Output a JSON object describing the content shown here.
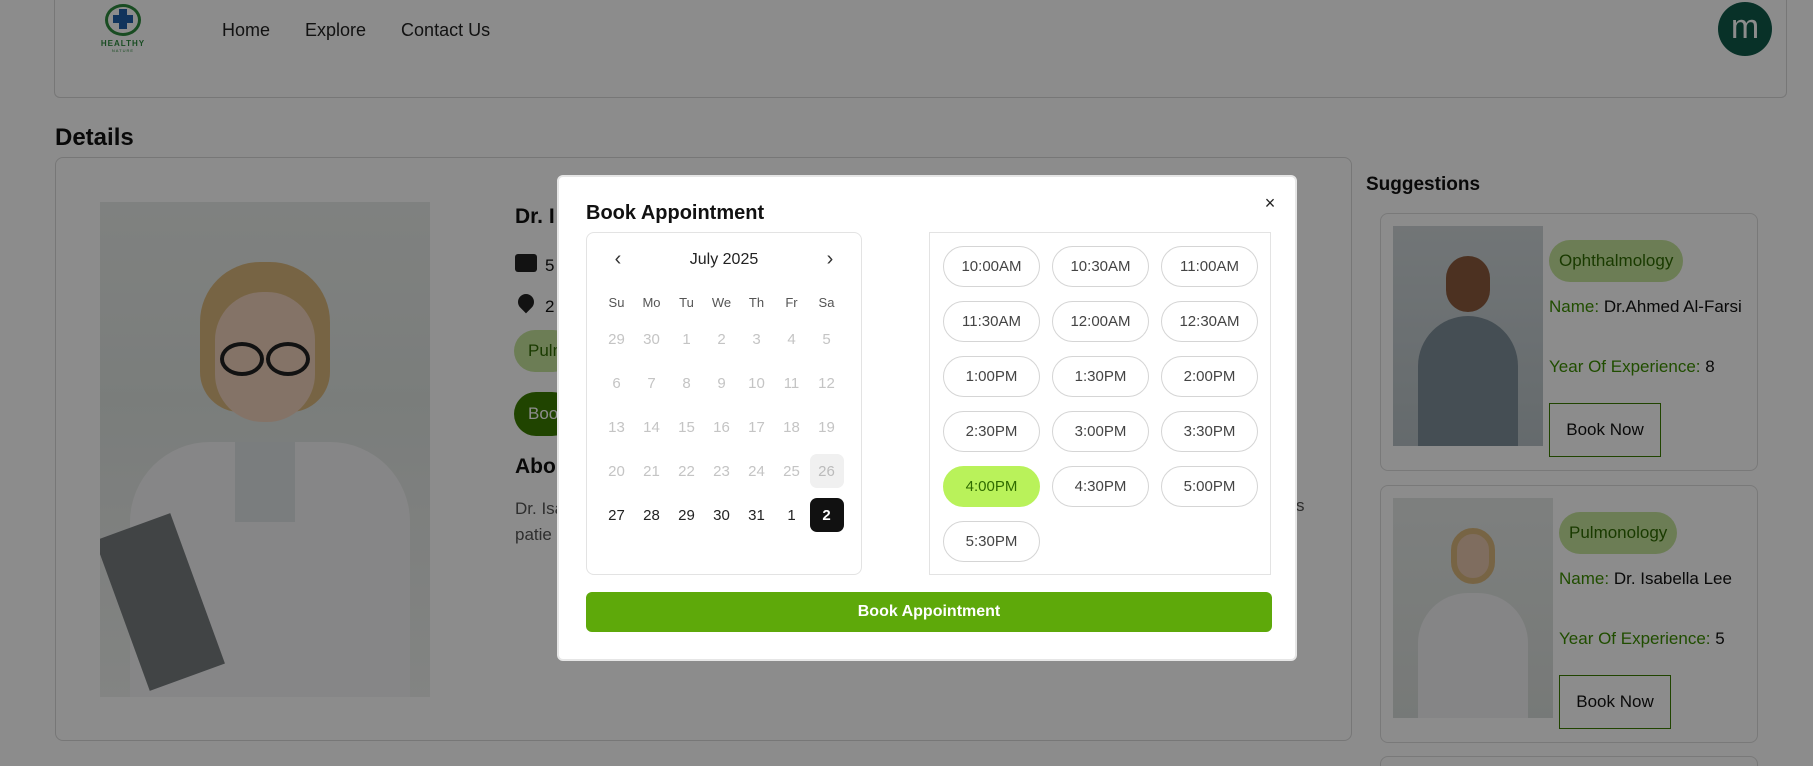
{
  "nav": {
    "logo_text": "HEALTHY",
    "logo_sub": "NATURE",
    "links": [
      "Home",
      "Explore",
      "Contact Us"
    ],
    "avatar_letter": "m"
  },
  "details": {
    "title": "Details",
    "doctor_name": "Dr. I",
    "experience_text": "5",
    "location_text": "2",
    "specialty_tag": "Pulmonology",
    "book_label": "Book",
    "about_title": "Abo",
    "about_line1": "Dr. Isa",
    "about_line2": "patie",
    "about_tail": "s"
  },
  "suggestions": {
    "title": "Suggestions",
    "items": [
      {
        "specialty": "Ophthalmology",
        "name_label": "Name:",
        "name": "Dr.Ahmed Al-Farsi",
        "exp_label": "Year Of Experience:",
        "experience": "8",
        "button": "Book Now"
      },
      {
        "specialty": "Pulmonology",
        "name_label": "Name:",
        "name": "Dr. Isabella Lee",
        "exp_label": "Year Of Experience:",
        "experience": "5",
        "button": "Book Now"
      }
    ]
  },
  "modal": {
    "title": "Book Appointment",
    "close_symbol": "×",
    "calendar": {
      "month_label": "July 2025",
      "prev_symbol": "‹",
      "next_symbol": "›",
      "weekdays": [
        "Su",
        "Mo",
        "Tu",
        "We",
        "Th",
        "Fr",
        "Sa"
      ],
      "weeks": [
        [
          "29",
          "30",
          "1",
          "2",
          "3",
          "4",
          "5"
        ],
        [
          "6",
          "7",
          "8",
          "9",
          "10",
          "11",
          "12"
        ],
        [
          "13",
          "14",
          "15",
          "16",
          "17",
          "18",
          "19"
        ],
        [
          "20",
          "21",
          "22",
          "23",
          "24",
          "25",
          "26"
        ],
        [
          "27",
          "28",
          "29",
          "30",
          "31",
          "1",
          "2"
        ]
      ],
      "today": "26",
      "selected": "2"
    },
    "time_slots": [
      "10:00AM",
      "10:30AM",
      "11:00AM",
      "11:30AM",
      "12:00AM",
      "12:30AM",
      "1:00PM",
      "1:30PM",
      "2:00PM",
      "2:30PM",
      "3:00PM",
      "3:30PM",
      "4:00PM",
      "4:30PM",
      "5:00PM",
      "5:30PM"
    ],
    "selected_slot": "4:00PM",
    "submit_label": "Book Appointment"
  },
  "colors": {
    "accent_green": "#5ea90a",
    "slot_active": "#b9f25a",
    "avatar_bg": "#0f5a4a"
  }
}
